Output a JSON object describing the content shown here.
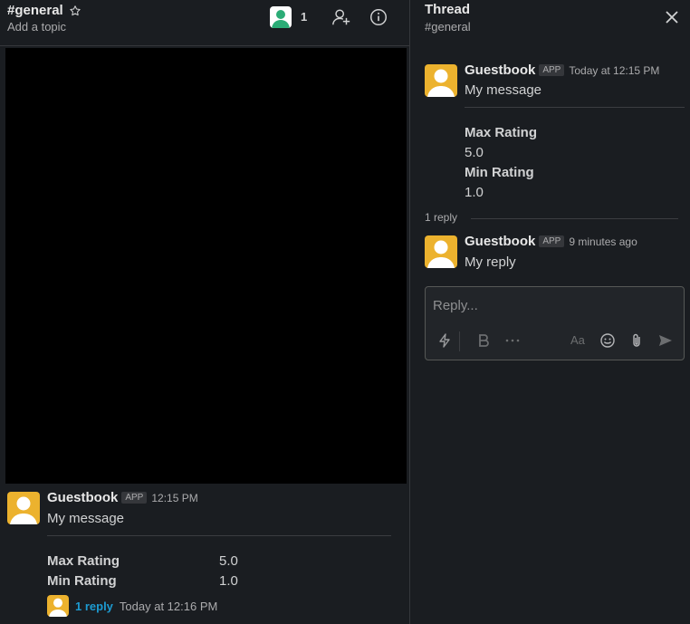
{
  "channel": {
    "name": "#general",
    "topic_placeholder": "Add a topic",
    "member_count": "1"
  },
  "main_message": {
    "sender": "Guestbook",
    "badge": "APP",
    "time": "12:15 PM",
    "text": "My message",
    "fields": [
      {
        "label": "Max Rating",
        "value": "5.0"
      },
      {
        "label": "Min Rating",
        "value": "1.0"
      }
    ],
    "replies_link": "1 reply",
    "last_reply_time": "Today at 12:16 PM"
  },
  "thread": {
    "title": "Thread",
    "channel": "#general",
    "parent": {
      "sender": "Guestbook",
      "badge": "APP",
      "time": "Today at 12:15 PM",
      "text": "My message",
      "fields": [
        {
          "label": "Max Rating",
          "value": "5.0"
        },
        {
          "label": "Min Rating",
          "value": "1.0"
        }
      ]
    },
    "reply_count": "1 reply",
    "reply": {
      "sender": "Guestbook",
      "badge": "APP",
      "time": "9 minutes ago",
      "text": "My reply"
    },
    "composer": {
      "placeholder": "Reply...",
      "format_label": "Aa"
    }
  },
  "colors": {
    "avatar_yellow": "#ecb22e",
    "member_avatar": "#2bac76",
    "link": "#1d9bd1"
  }
}
